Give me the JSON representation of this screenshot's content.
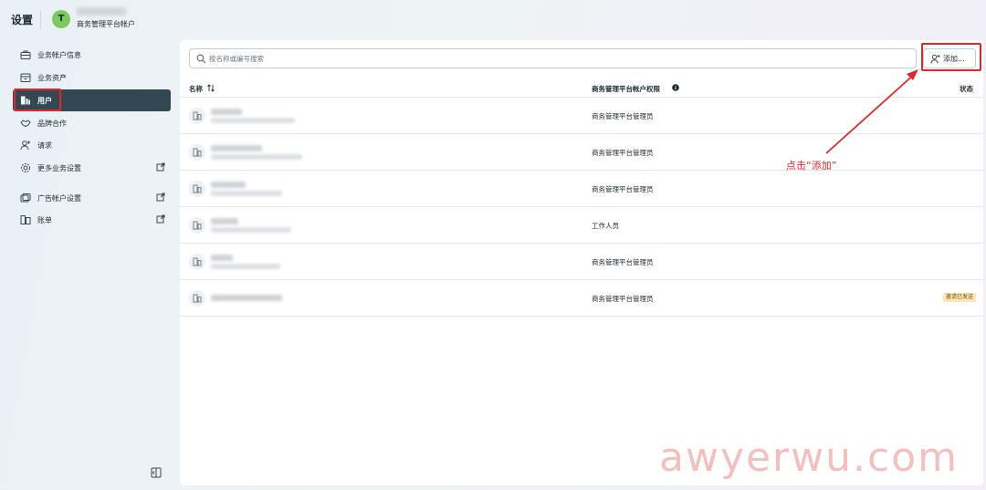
{
  "header": {
    "title": "设置",
    "avatar_letter": "T",
    "account_type": "商务管理平台帐户"
  },
  "sidebar": {
    "items": [
      {
        "label": "业务帐户信息",
        "icon": "briefcase-icon"
      },
      {
        "label": "业务资产",
        "icon": "assets-icon"
      },
      {
        "label": "用户",
        "icon": "users-icon"
      },
      {
        "label": "品牌合作",
        "icon": "handshake-icon"
      },
      {
        "label": "请求",
        "icon": "person-add-icon"
      },
      {
        "label": "更多业务设置",
        "icon": "gear-icon"
      },
      {
        "label": "广告帐户设置",
        "icon": "ad-account-icon"
      },
      {
        "label": "账单",
        "icon": "billing-icon"
      }
    ]
  },
  "main": {
    "search_placeholder": "按名称或编号搜索",
    "add_label": "添加...",
    "columns": {
      "name": "名称",
      "permission": "商务管理平台帐户权限",
      "status": "状态"
    },
    "rows": [
      {
        "role": "商务管理平台管理员",
        "status": ""
      },
      {
        "role": "商务管理平台管理员",
        "status": ""
      },
      {
        "role": "商务管理平台管理员",
        "status": ""
      },
      {
        "role": "工作人员",
        "status": ""
      },
      {
        "role": "商务管理平台管理员",
        "status": ""
      },
      {
        "role": "商务管理平台管理员",
        "status": "邀请已发送"
      }
    ]
  },
  "annotation": {
    "text": "点击“添加”",
    "color": "#e0282c"
  },
  "watermark": "awyerwu.com",
  "colors": {
    "active_nav": "#344854",
    "avatar": "#7ec95f",
    "badge_bg": "#fbe6b8"
  }
}
